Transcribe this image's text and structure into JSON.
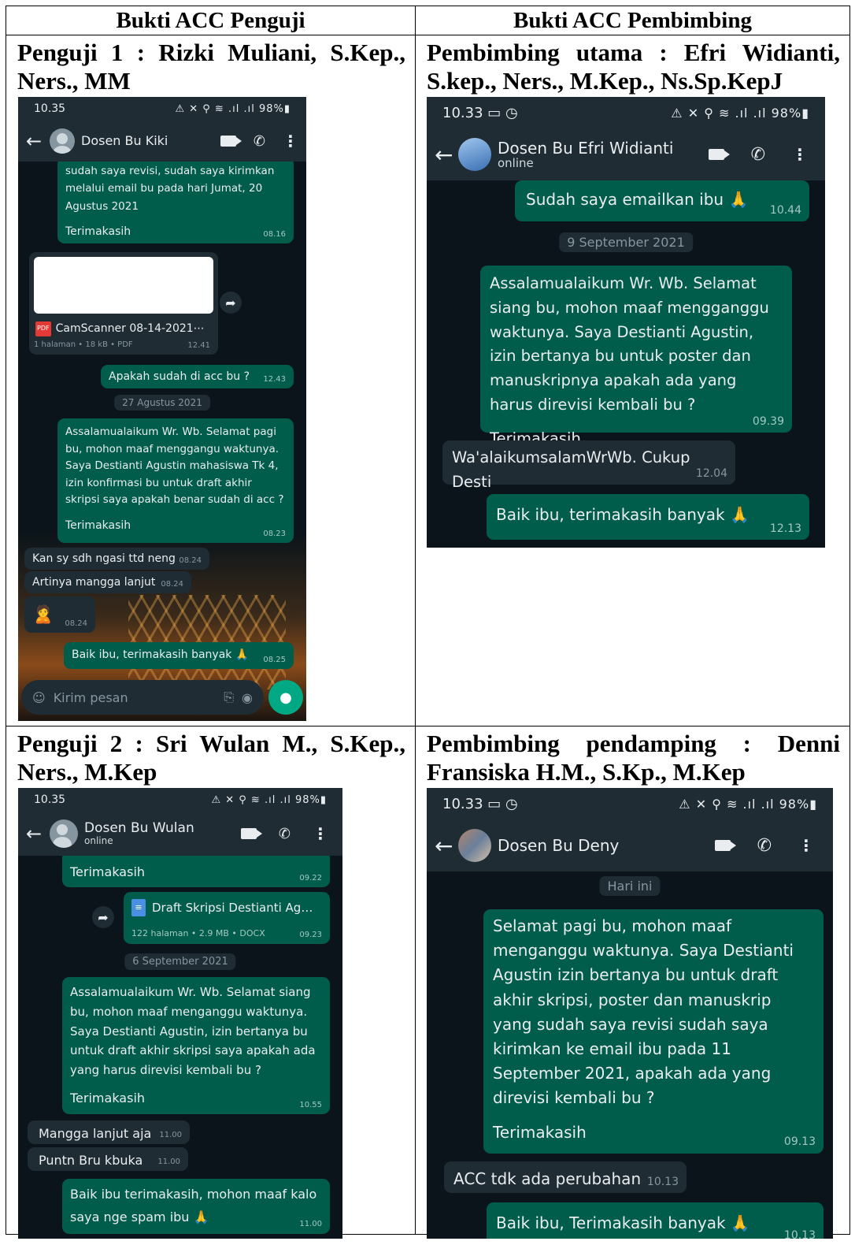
{
  "headers": {
    "left": "Bukti ACC Penguji",
    "right": "Bukti ACC Pembimbing"
  },
  "captions": {
    "p1_line1": "Penguji 1 : Rizki Muliani, S.Kep.,",
    "p1_line2": "Ners., MM",
    "pu_line1": "Pembimbing utama : Efri Widianti,",
    "pu_line2": "S.kep., Ners., M.Kep., Ns.Sp.KepJ",
    "p2_line1": "Penguji 2 : Sri Wulan M., S.Kep.,",
    "p2_line2": "Ners., M.Kep",
    "pp_line1": "Pembimbing pendamping : Denni",
    "pp_line2": "Fransiska H.M., S.Kp., M.Kep"
  },
  "status_icons": {
    "battery": "98%"
  },
  "chat_kiki": {
    "time": "10.35",
    "contact": "Dosen Bu Kiki",
    "m1": "sudah saya revisi, sudah saya kirimkan melalui email bu pada hari Jumat, 20 Agustus 2021",
    "m1b": "Terimakasih",
    "m1_t": "08.16",
    "file_name": "CamScanner 08-14-2021⋯",
    "file_meta": "1 halaman • 18 kB • PDF",
    "file_t": "12.41",
    "m2": "Apakah sudah di acc bu ?",
    "m2_t": "12.43",
    "date": "27 Agustus 2021",
    "m3": "Assalamualaikum Wr. Wb. Selamat pagi bu, mohon maaf menggangu waktunya. Saya Destianti Agustin mahasiswa Tk 4, izin konfirmasi bu untuk draft akhir skripsi saya apakah benar sudah di acc ?",
    "m3b": "Terimakasih",
    "m3_t": "08.23",
    "r1": "Kan sy sdh ngasi ttd neng",
    "r1_t": "08.24",
    "r2": "Artinya mangga lanjut",
    "r2_t": "08.24",
    "r3_t": "08.24",
    "m4": "Baik ibu, terimakasih banyak",
    "m4_t": "08.25",
    "composer": "Kirim pesan"
  },
  "chat_efri": {
    "time": "10.33",
    "contact": "Dosen Bu Efri Widianti",
    "status": "online",
    "m1": "Sudah saya emailkan ibu",
    "m1_t": "10.44",
    "date": "9 September 2021",
    "m2": "Assalamualaikum Wr. Wb. Selamat siang bu, mohon maaf mengganggu waktunya. Saya Destianti Agustin, izin bertanya bu untuk poster dan manuskripnya apakah ada yang harus direvisi kembali bu ?",
    "m2b": "Terimakasih",
    "m2_t": "09.39",
    "r1": "Wa'alaikumsalamWrWb. Cukup Desti",
    "r1_t": "12.04",
    "m3": "Baik ibu, terimakasih banyak",
    "m3_t": "12.13"
  },
  "chat_wulan": {
    "time": "10.35",
    "contact": "Dosen Bu Wulan",
    "status": "online",
    "m1": "Terimakasih",
    "m1_t": "09.22",
    "file_name": "Draft Skripsi Destianti Ag…",
    "file_meta": "122 halaman • 2.9 MB • DOCX",
    "file_t": "09.23",
    "date": "6 September 2021",
    "m2": "Assalamualaikum Wr. Wb. Selamat siang bu, mohon maaf menganggu waktunya. Saya Destianti Agustin, izin bertanya bu untuk draft akhir skripsi saya apakah ada yang harus direvisi kembali bu ?",
    "m2b": "Terimakasih",
    "m2_t": "10.55",
    "r1": "Mangga lanjut aja",
    "r1_t": "11.00",
    "r2": "Puntn Bru kbuka",
    "r2_t": "11.00",
    "m3": "Baik ibu terimakasih, mohon maaf kalo saya nge spam ibu",
    "m3_t": "11.00"
  },
  "chat_deny": {
    "time": "10.33",
    "contact": "Dosen Bu Deny",
    "date": "Hari ini",
    "m1": "Selamat pagi bu, mohon maaf menganggu waktunya. Saya Destianti Agustin izin bertanya bu untuk draft akhir skripsi, poster dan manuskrip yang sudah saya revisi sudah saya kirimkan ke email ibu pada 11 September 2021, apakah ada yang direvisi kembali bu ?",
    "m1b": "Terimakasih",
    "m1_t": "09.13",
    "r1": "ACC tdk ada perubahan",
    "r1_t": "10.13",
    "m2": "Baik ibu, Terimakasih banyak",
    "m2_t": "10.13"
  }
}
